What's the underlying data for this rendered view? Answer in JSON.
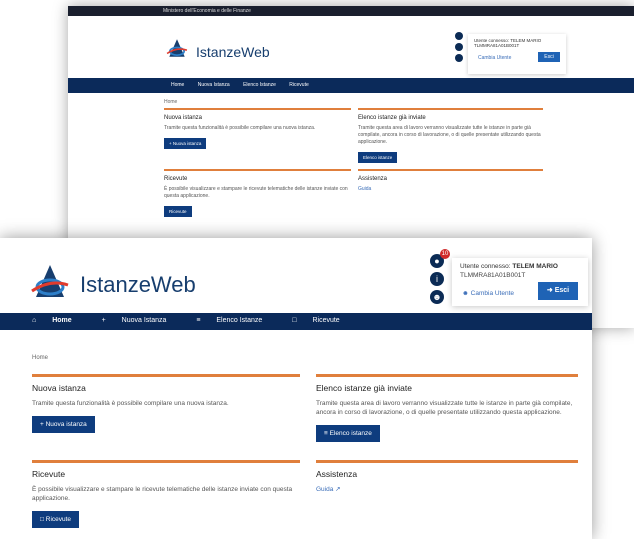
{
  "back": {
    "topbar": "Ministero dell'Economia e delle Finanze",
    "app_name": "IstanzeWeb",
    "user": {
      "line1": "Utente connesso: TELEM MARIO",
      "line2": "TLMMRA81A01B001T",
      "change": "Cambia Utente",
      "logout": "Esci"
    },
    "nav": [
      "Home",
      "Nuova Istanza",
      "Elenco Istanze",
      "Ricevute"
    ],
    "breadcrumb": "Home",
    "cards": {
      "nuova": {
        "title": "Nuova istanza",
        "desc": "Tramite questa funzionalità è possibile compilare una nuova istanza.",
        "btn": "+ Nuova istanza"
      },
      "elenco": {
        "title": "Elenco istanze già inviate",
        "desc": "Tramite questa area di lavoro verranno visualizzate tutte le istanze in parte già compilate, ancora in corso di lavorazione, o di quelle presentate utilizzando questa applicazione.",
        "btn": "Elenco istanze"
      },
      "ricevute": {
        "title": "Ricevute",
        "desc": "È possibile visualizzare e stampare le ricevute telematiche delle istanze inviate con questa applicazione.",
        "btn": "Ricevute"
      },
      "assistenza": {
        "title": "Assistenza",
        "link": "Guida"
      }
    }
  },
  "front": {
    "app_name": "IstanzeWeb",
    "notif_count": "10",
    "user": {
      "prefix": "Utente connesso: ",
      "name": "TELEM MARIO",
      "code": "TLMMRA81A01B001T",
      "change": "Cambia Utente",
      "logout": "Esci"
    },
    "nav": {
      "home": "Home",
      "nuova": "Nuova Istanza",
      "elenco": "Elenco Istanze",
      "ricevute": "Ricevute"
    },
    "breadcrumb": "Home",
    "cards": {
      "nuova": {
        "title": "Nuova istanza",
        "desc": "Tramite questa funzionalità è possibile compilare una nuova istanza.",
        "btn": "Nuova istanza"
      },
      "elenco": {
        "title": "Elenco istanze già inviate",
        "desc": "Tramite questa area di lavoro verranno visualizzate tutte le istanze in parte già compilate, ancora in corso di lavorazione, o di quelle presentate utilizzando questa applicazione.",
        "btn": "Elenco istanze"
      },
      "ricevute": {
        "title": "Ricevute",
        "desc": "È possibile visualizzare e stampare le ricevute telematiche delle istanze inviate con questa applicazione.",
        "btn": "Ricevute"
      },
      "assistenza": {
        "title": "Assistenza",
        "link": "Guida"
      }
    }
  },
  "colors": {
    "navy": "#0b2a5a",
    "accent": "#e07f3c",
    "button": "#0e3c7e",
    "logout": "#1f63b5"
  }
}
